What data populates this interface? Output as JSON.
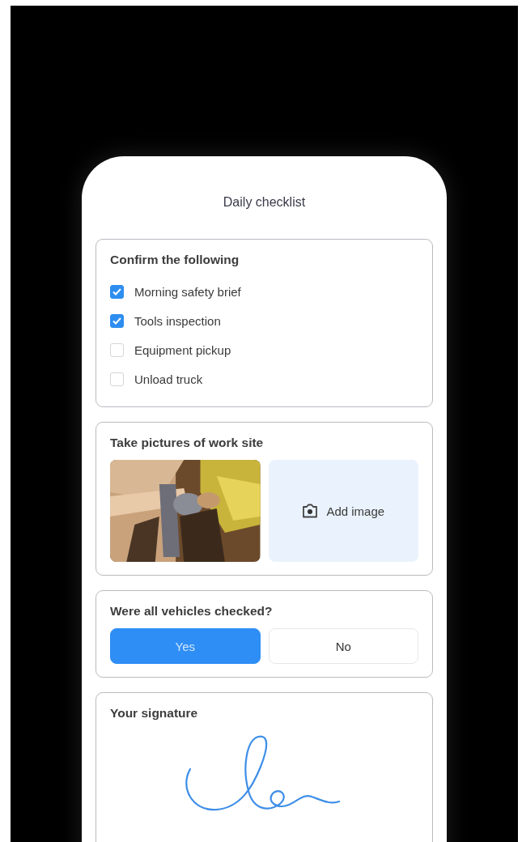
{
  "header": {
    "title": "Daily checklist"
  },
  "confirm": {
    "title": "Confirm the following",
    "items": [
      {
        "label": "Morning safety brief",
        "checked": true
      },
      {
        "label": "Tools inspection",
        "checked": true
      },
      {
        "label": "Equipment pickup",
        "checked": false
      },
      {
        "label": "Unload truck",
        "checked": false
      }
    ]
  },
  "pictures": {
    "title": "Take pictures of work site",
    "add_label": "Add image"
  },
  "vehicles": {
    "question": "Were all vehicles checked?",
    "options": [
      {
        "label": "Yes",
        "selected": true
      },
      {
        "label": "No",
        "selected": false
      }
    ]
  },
  "signature": {
    "title": "Your signature"
  }
}
